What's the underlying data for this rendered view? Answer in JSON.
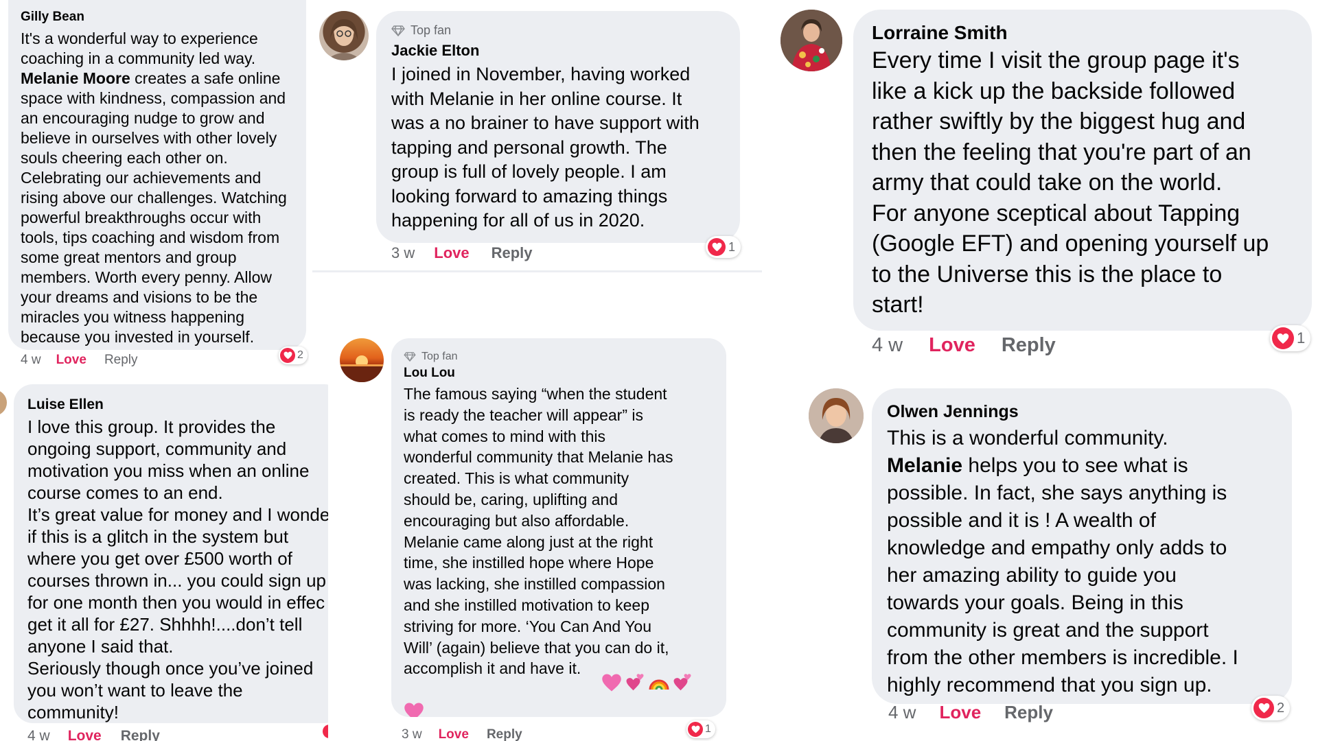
{
  "labels": {
    "love": "Love",
    "reply": "Reply",
    "top_fan": "Top fan"
  },
  "colors": {
    "bubble": "#eceef2",
    "love": "#e0245e",
    "heart": "#f0284a",
    "meta": "#65676b"
  },
  "comments": {
    "gilly": {
      "name": "Gilly Bean",
      "text_pre": "It's a wonderful way to experience\ncoaching in a community led way.",
      "bold": "Melanie Moore",
      "text_post": " creates a safe online\nspace with kindness, compassion and\nan encouraging nudge to grow and\nbelieve in ourselves with other lovely\nsouls cheering each other on.\nCelebrating our achievements and\nrising above our challenges. Watching\npowerful breakthroughs occur with\ntools, tips coaching and wisdom from\nsome great mentors and group\nmembers. Worth every penny. Allow\nyour dreams and visions to be the\nmiracles you witness happening\nbecause you invested in yourself.",
      "time": "4 w",
      "reactions": "2"
    },
    "jackie": {
      "badge": "Top fan",
      "name": "Jackie Elton",
      "text": "I joined in November, having worked\nwith Melanie in her online course. It\nwas a no brainer to have support with\ntapping and personal growth. The\ngroup is full of lovely people. I am\nlooking forward to amazing things\nhappening for all of us in 2020.",
      "time": "3 w",
      "reactions": "1"
    },
    "lorraine": {
      "name": "Lorraine Smith",
      "text": "Every time I visit the group page it's\nlike a kick up the backside followed\nrather swiftly by the biggest hug and\nthen the feeling that you're part of an\narmy that could take on the world.\nFor anyone sceptical about Tapping\n(Google EFT) and opening yourself up\nto the Universe this is the place to\nstart!",
      "time": "4 w",
      "reactions": "1"
    },
    "luise": {
      "name": "Luise Ellen",
      "text": "I love this group. It provides the\nongoing support, community and\nmotivation you miss when an online\ncourse comes to an end.\nIt’s great value for money and I wonde\nif this is a glitch in the system but\nwhere you get over £500 worth of\ncourses thrown in... you could sign up\nfor one month then you would in effec\nget it all for £27. Shhhh!....don’t tell\nanyone I said that.\nSeriously though once you’ve joined\nyou won’t want to leave the\ncommunity!",
      "time": "4 w"
    },
    "loulou": {
      "badge": "Top fan",
      "name": "Lou Lou",
      "text": "The famous saying “when the student\nis ready the teacher will appear” is\nwhat comes to mind with this\nwonderful community that Melanie has\ncreated. This is what community\nshould be, caring, uplifting and\nencouraging but also affordable.\nMelanie came along just at the right\ntime, she instilled hope where Hope\nwas lacking, she instilled compassion\nand she instilled motivation to keep\nstriving for more. ‘You Can And You\nWill’ (again) believe that you can do it,\naccomplish it and have it.",
      "emojis": [
        "sparkling-heart",
        "two-hearts",
        "rainbow",
        "two-hearts",
        "sparkling-heart"
      ],
      "time": "3 w",
      "reactions": "1"
    },
    "olwen": {
      "name": "Olwen Jennings",
      "text_pre": "This is a wonderful community.",
      "bold": "Melanie",
      "text_post": " helps you to see what is\npossible. In fact, she says anything is\npossible and it is ! A wealth of\nknowledge and empathy only adds to\nher amazing ability to guide you\ntowards your goals. Being in this\ncommunity is great and the support\nfrom the other members is incredible. I\nhighly recommend that you sign up.",
      "time": "4 w",
      "reactions": "2"
    }
  }
}
